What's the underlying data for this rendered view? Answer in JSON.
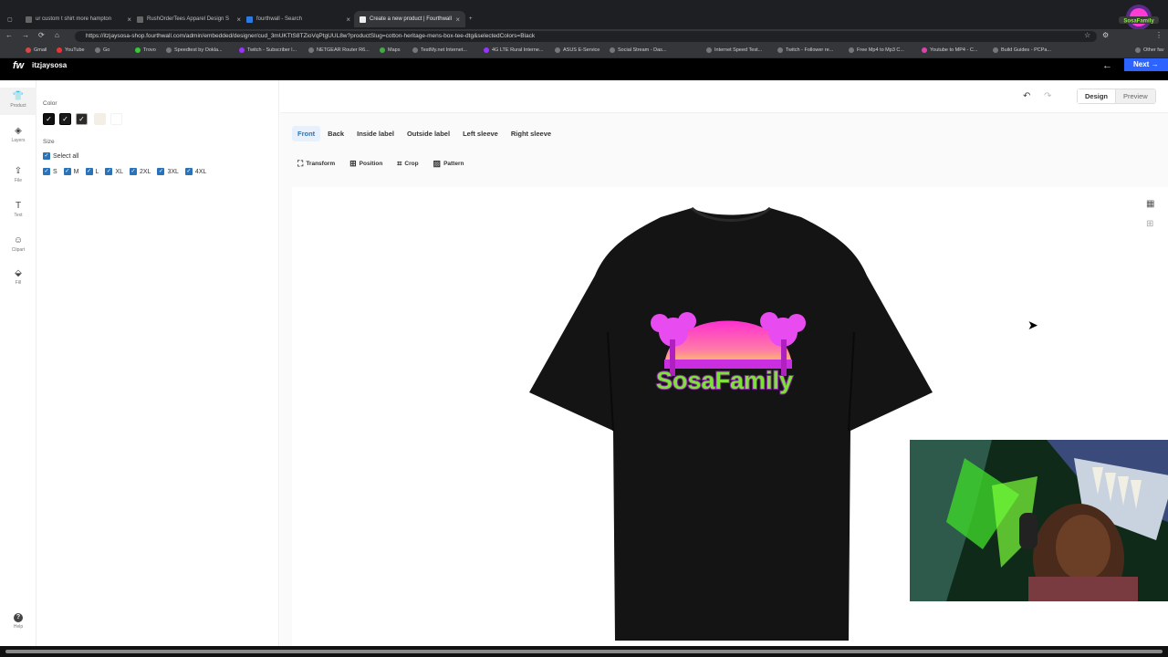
{
  "browser": {
    "tabs": [
      {
        "title": "ur custom t shirt more hampton",
        "active": false
      },
      {
        "title": "RushOrderTees Apparel Design S",
        "active": false
      },
      {
        "title": "fourthwall - Search",
        "active": false
      },
      {
        "title": "Create a new product | Fourthwall",
        "active": true
      }
    ],
    "url": "https://itzjaysosa-shop.fourthwall.com/admin/embedded/designer/cud_3mUKTtS8TZioVqPtgUUL8w?productSlug=cotton-heritage-mens-box-tee-dtg&selectedColors=Black",
    "bookmarks": [
      "Gmail",
      "YouTube",
      "Go",
      "Trovo",
      "Speedtest by Ookla...",
      "Twitch - Subscriber l...",
      "NETGEAR Router R6...",
      "Maps",
      "TestMy.net Internet...",
      "4G LTE Rural Interne...",
      "ASUS E-Service",
      "Social Stream - Das...",
      "Internet Speed Test...",
      "Twitch - Follower re...",
      "Free Mp4 to Mp3 C...",
      "Youtube to MP4 - C...",
      "Build Guides - PCPa...",
      "Other fav"
    ]
  },
  "app": {
    "logo": "fw",
    "shop_name": "itzjaysosa",
    "next_label": "Next"
  },
  "rail": [
    {
      "label": "Product",
      "icon": "shirt-icon"
    },
    {
      "label": "Layers",
      "icon": "layers-icon"
    },
    {
      "label": "File",
      "icon": "upload-icon"
    },
    {
      "label": "Text",
      "icon": "text-icon"
    },
    {
      "label": "Clipart",
      "icon": "smiley-icon"
    },
    {
      "label": "Fill",
      "icon": "paint-bucket-icon"
    }
  ],
  "help_label": "Help",
  "panel": {
    "color_label": "Color",
    "colors": [
      "#111111",
      "#1b1b1b",
      "#2c2a27",
      "#f4efe6",
      "#ffffff"
    ],
    "size_label": "Size",
    "select_all": "Select all",
    "sizes": [
      "S",
      "M",
      "L",
      "XL",
      "2XL",
      "3XL",
      "4XL"
    ]
  },
  "mode": {
    "design": "Design",
    "preview": "Preview"
  },
  "placements": [
    "Front",
    "Back",
    "Inside label",
    "Outside label",
    "Left sleeve",
    "Right sleeve"
  ],
  "tools": [
    "Transform",
    "Position",
    "Crop",
    "Pattern"
  ],
  "artwork": {
    "text": "SosaFamily",
    "accent": "#e84cf0",
    "text_color": "#7ee03a",
    "shirt_color": "#111111"
  }
}
